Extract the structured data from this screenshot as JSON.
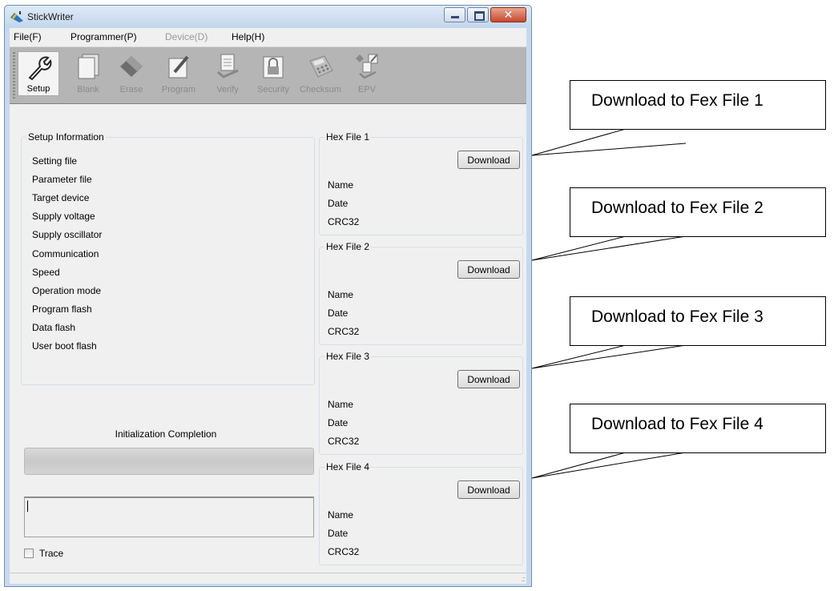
{
  "window": {
    "title": "StickWriter"
  },
  "menu": [
    {
      "label": "File(F)",
      "enabled": true
    },
    {
      "label": "Programmer(P)",
      "enabled": true
    },
    {
      "label": "Device(D)",
      "enabled": false
    },
    {
      "label": "Help(H)",
      "enabled": true
    }
  ],
  "toolbar": [
    {
      "label": "Setup",
      "icon": "wrench-icon",
      "enabled": true
    },
    {
      "label": "Blank",
      "icon": "blank-pages-icon",
      "enabled": false
    },
    {
      "label": "Erase",
      "icon": "eraser-icon",
      "enabled": false
    },
    {
      "label": "Program",
      "icon": "pencil-icon",
      "enabled": false
    },
    {
      "label": "Verify",
      "icon": "verify-icon",
      "enabled": false
    },
    {
      "label": "Security",
      "icon": "lock-icon",
      "enabled": false
    },
    {
      "label": "Checksum",
      "icon": "calculator-icon",
      "enabled": false
    },
    {
      "label": "EPV",
      "icon": "epv-icon",
      "enabled": false
    }
  ],
  "setup": {
    "title": "Setup Information",
    "items": [
      "Setting file",
      "Parameter file",
      "Target device",
      "Supply voltage",
      "Supply oscillator",
      "Communication",
      "Speed",
      "Operation mode",
      "Program flash",
      "Data flash",
      "User boot flash"
    ]
  },
  "hex_files": [
    {
      "title": "Hex File 1",
      "button": "Download",
      "name_label": "Name",
      "date_label": "Date",
      "crc_label": "CRC32"
    },
    {
      "title": "Hex File 2",
      "button": "Download",
      "name_label": "Name",
      "date_label": "Date",
      "crc_label": "CRC32"
    },
    {
      "title": "Hex File 3",
      "button": "Download",
      "name_label": "Name",
      "date_label": "Date",
      "crc_label": "CRC32"
    },
    {
      "title": "Hex File 4",
      "button": "Download",
      "name_label": "Name",
      "date_label": "Date",
      "crc_label": "CRC32"
    }
  ],
  "status": {
    "init_text": "Initialization Completion",
    "trace_label": "Trace",
    "trace_checked": false,
    "log_text": ""
  },
  "callouts": [
    "Download to Fex File 1",
    "Download to Fex File 2",
    "Download to Fex File 3",
    "Download to Fex File 4"
  ],
  "colors": {
    "titlebar": "#c6d9ef",
    "toolbar_bg": "#b5b5b5",
    "close_button": "#c7492f",
    "client_bg": "#f0f0f0"
  }
}
